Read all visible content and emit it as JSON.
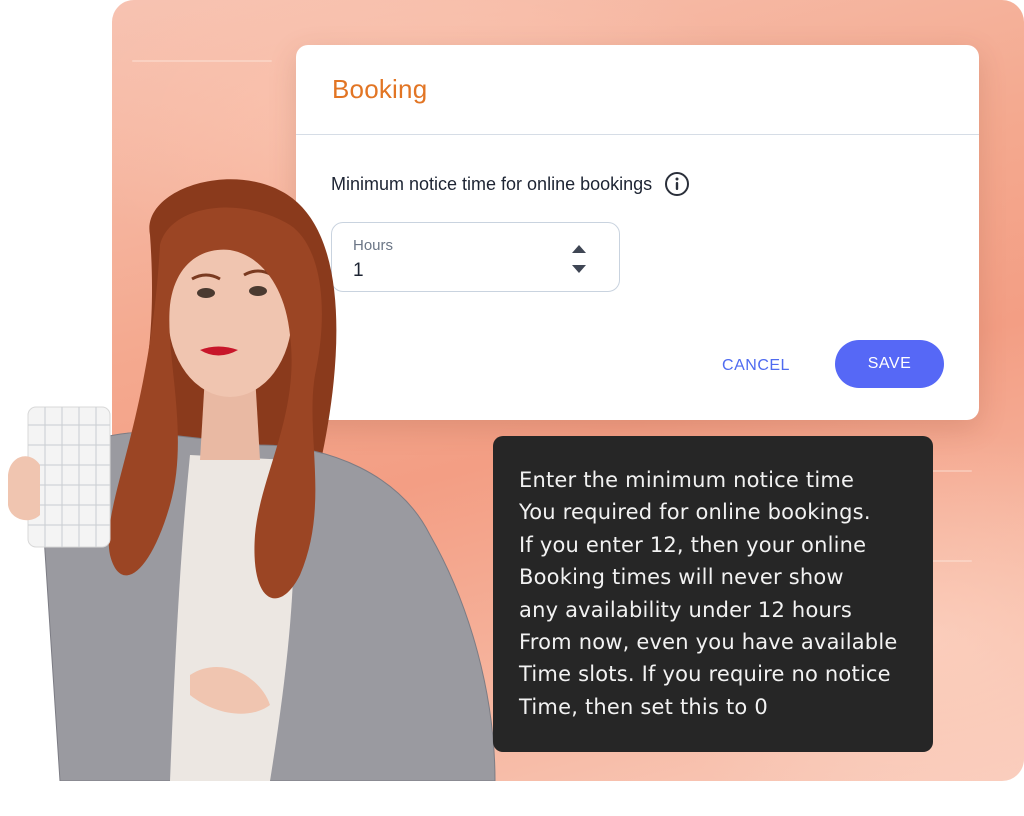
{
  "card": {
    "title": "Booking",
    "field_label": "Minimum notice time for online bookings",
    "info_icon": "info-icon",
    "stepper": {
      "caption": "Hours",
      "value": "1"
    },
    "cancel_label": "CANCEL",
    "save_label": "SAVE"
  },
  "tooltip": {
    "lines": [
      "Enter the minimum notice time",
      "You required for online bookings.",
      "If you enter 12, then your online",
      "Booking times will never show",
      "any availability under 12 hours",
      "From now, even you have available",
      "Time slots. If you require no notice",
      "Time, then set this to 0"
    ]
  },
  "colors": {
    "title": "#e27524",
    "accent": "#5668f6",
    "tooltip_bg": "#262626",
    "backdrop": "#f4a98f"
  }
}
